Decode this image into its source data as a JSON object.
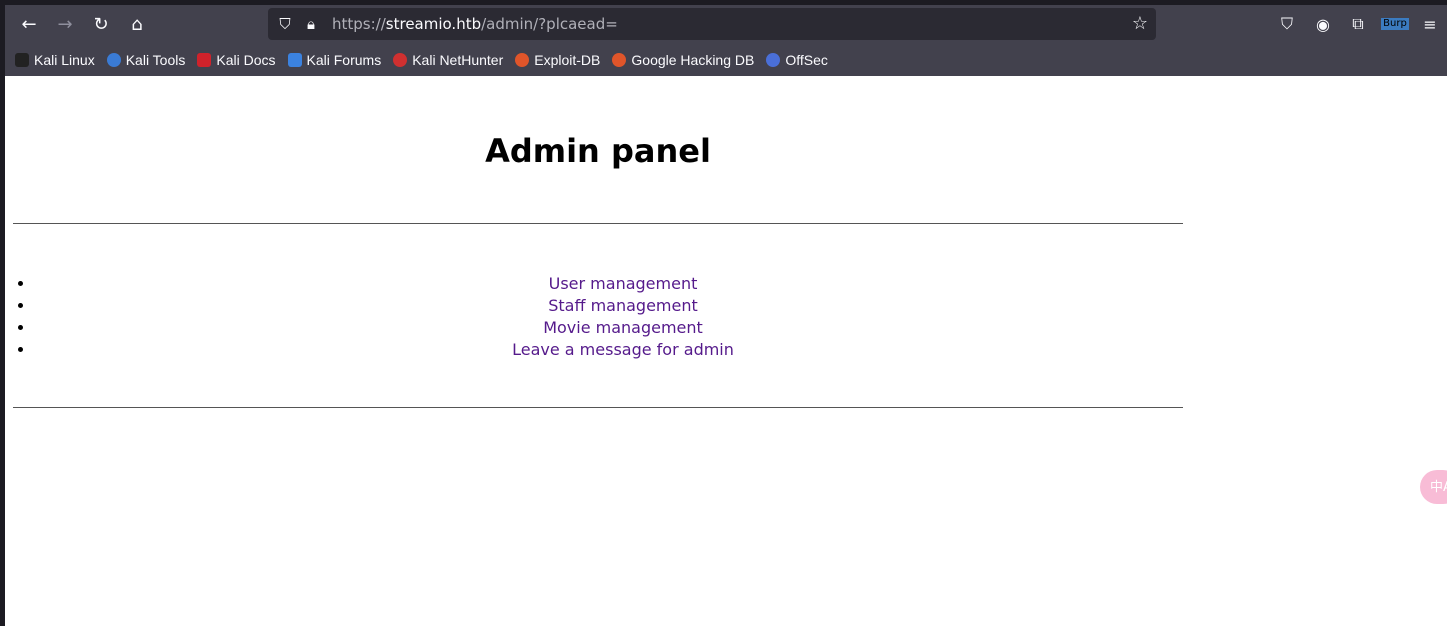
{
  "browser": {
    "url_prefix": "https://",
    "url_host": "streamio.htb",
    "url_path": "/admin/?plcaead=",
    "extension_label": "Burp",
    "bookmarks": [
      "Kali Linux",
      "Kali Tools",
      "Kali Docs",
      "Kali Forums",
      "Kali NetHunter",
      "Exploit-DB",
      "Google Hacking DB",
      "OffSec"
    ]
  },
  "page": {
    "title": "Admin panel",
    "links": [
      "User management",
      "Staff management",
      "Movie management",
      "Leave a message for admin"
    ],
    "link_color": "#551a8b"
  },
  "translate_label": "中A"
}
